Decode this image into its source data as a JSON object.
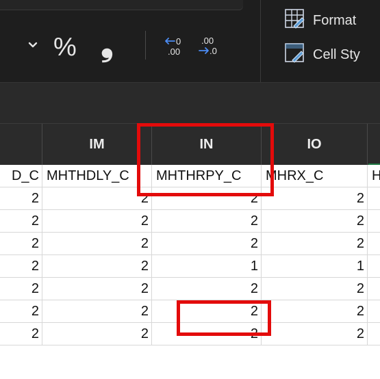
{
  "ribbon": {
    "chevron_icon": "chevron-down-icon",
    "percent_label": "%",
    "comma_label": "❟",
    "increase_decimal_icon": "increase-decimal-icon",
    "decrease_decimal_icon": "decrease-decimal-icon",
    "format_label": "Format",
    "cell_styles_label": "Cell Sty"
  },
  "columns": [
    "IM",
    "IN",
    "IO"
  ],
  "header_row": {
    "c0": "D_C",
    "c1": "MHTHDLY_C",
    "c2": "MHTHRPY_C",
    "c3": "MHRX_C",
    "c4": "H"
  },
  "rows": [
    [
      "2",
      "2",
      "2",
      "2"
    ],
    [
      "2",
      "2",
      "2",
      "2"
    ],
    [
      "2",
      "2",
      "2",
      "2"
    ],
    [
      "2",
      "2",
      "1",
      "1"
    ],
    [
      "2",
      "2",
      "2",
      "2"
    ],
    [
      "2",
      "2",
      "2",
      "2"
    ],
    [
      "2",
      "2",
      "2",
      "2"
    ]
  ],
  "colors": {
    "highlight": "#e30b0b",
    "ribbon_bg": "#1e1e1e",
    "accent_green": "#1f7a44"
  }
}
